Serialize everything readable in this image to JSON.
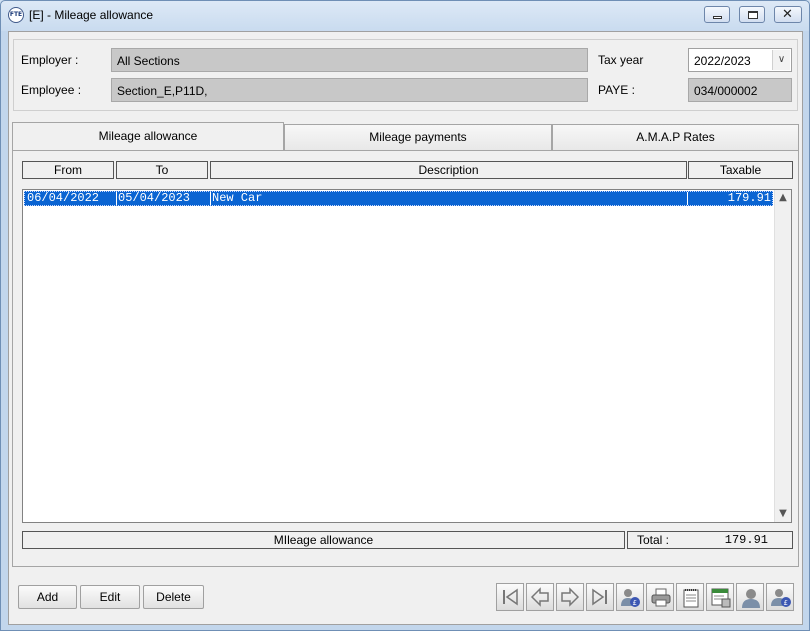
{
  "window": {
    "icon_text": "FTE",
    "title": "[E] - Mileage allowance"
  },
  "header": {
    "employer_label": "Employer :",
    "employer_value": "All Sections",
    "employee_label": "Employee :",
    "employee_value": "Section_E,P11D,",
    "tax_year_label": "Tax year",
    "tax_year_value": "2022/2023",
    "paye_label": "PAYE :",
    "paye_value": "034/000002"
  },
  "tabs": [
    {
      "label": "Mileage allowance",
      "active": true
    },
    {
      "label": "Mileage payments",
      "active": false
    },
    {
      "label": "A.M.A.P Rates",
      "active": false
    }
  ],
  "table": {
    "columns": [
      "From",
      "To",
      "Description",
      "Taxable"
    ],
    "rows": [
      {
        "from": "06/04/2022",
        "to": "05/04/2023",
        "description": "New Car",
        "taxable": "179.91"
      }
    ]
  },
  "footer": {
    "summary_label": "MIleage allowance",
    "total_label": "Total :",
    "total_value": "179.91"
  },
  "buttons": {
    "add": "Add",
    "edit": "Edit",
    "delete": "Delete"
  },
  "nav_icons": [
    "first-record-icon",
    "previous-record-icon",
    "next-record-icon",
    "last-record-icon",
    "employee-pay-icon",
    "printer-icon",
    "notepad-icon",
    "calculator-sheet-icon",
    "employee-icon",
    "employee-payment-icon"
  ],
  "colors": {
    "selection": "#0a64d2",
    "field_background": "#c8c8c8",
    "window_frame": "#c2d6ec"
  }
}
